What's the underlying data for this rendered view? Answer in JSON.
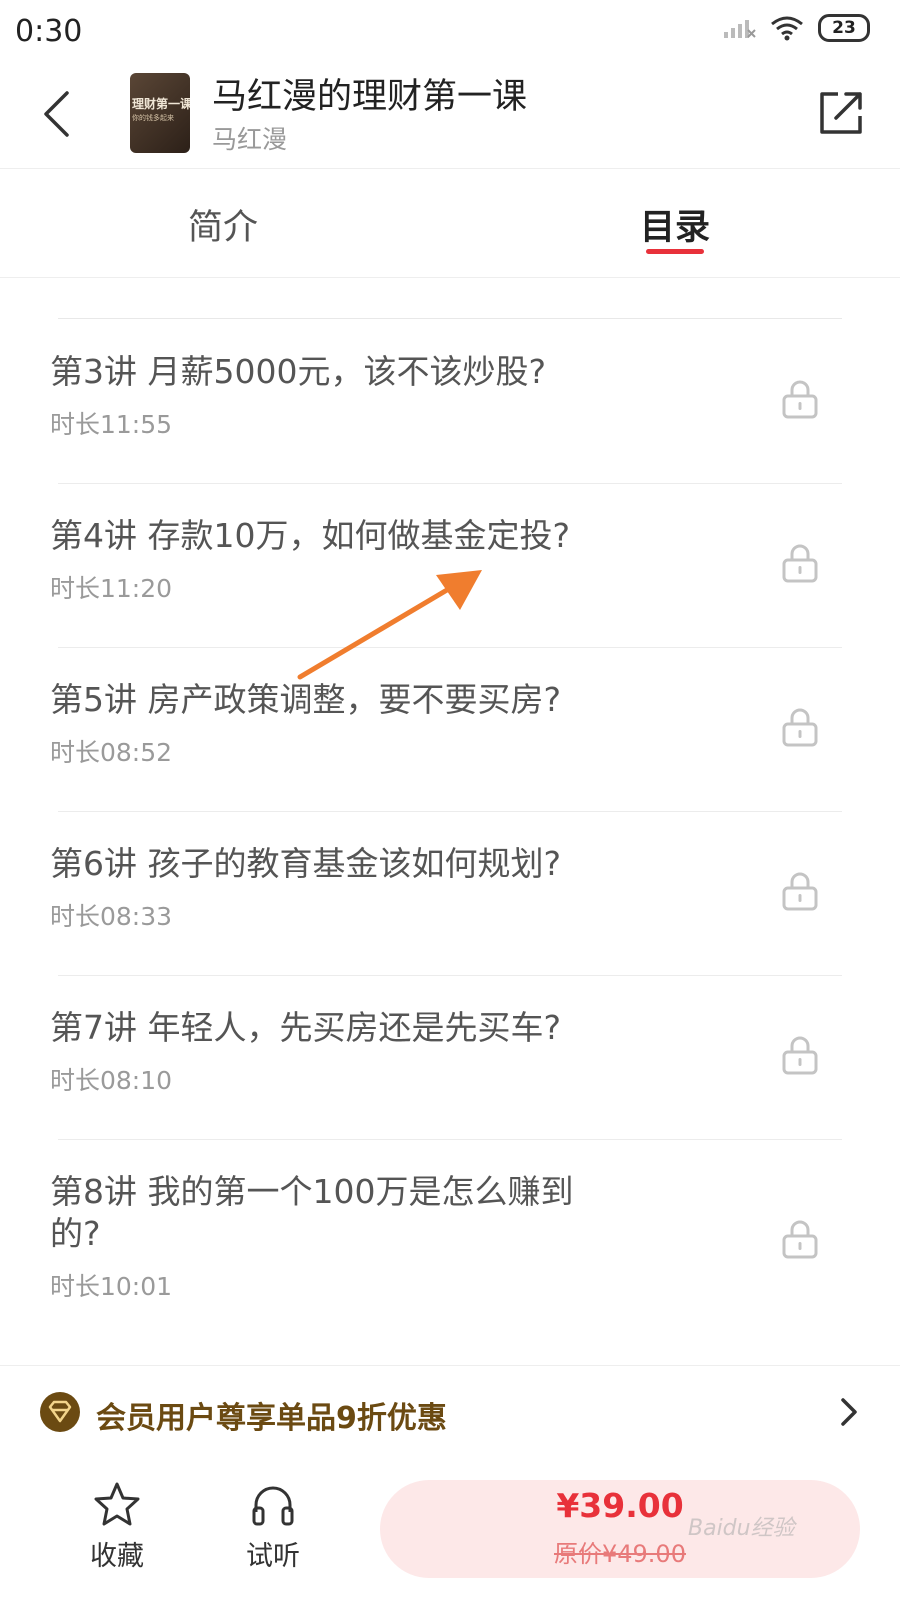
{
  "status_bar": {
    "time": "0:30",
    "battery": "23"
  },
  "header": {
    "title": "马红漫的理财第一课",
    "author": "马红漫",
    "cover_title": "理财第一课",
    "cover_subtitle": "你的钱多起来"
  },
  "tabs": [
    {
      "label": "简介",
      "active": false
    },
    {
      "label": "目录",
      "active": true
    }
  ],
  "lessons": [
    {
      "title": "第3讲 月薪5000元，该不该炒股?",
      "duration": "时长11:55",
      "locked": true
    },
    {
      "title": "第4讲 存款10万，如何做基金定投?",
      "duration": "时长11:20",
      "locked": true
    },
    {
      "title": "第5讲 房产政策调整，要不要买房?",
      "duration": "时长08:52",
      "locked": true
    },
    {
      "title": "第6讲 孩子的教育基金该如何规划?",
      "duration": "时长08:33",
      "locked": true
    },
    {
      "title": "第7讲 年轻人，先买房还是先买车?",
      "duration": "时长08:10",
      "locked": true
    },
    {
      "title": "第8讲 我的第一个100万是怎么赚到的?",
      "duration": "时长10:01",
      "locked": true
    }
  ],
  "member_banner": {
    "text": "会员用户尊享单品9折优惠"
  },
  "bottom_bar": {
    "favorite_label": "收藏",
    "listen_label": "试听",
    "price": "¥39.00",
    "original_price": "原价¥49.00"
  },
  "watermark": "Baidu经验",
  "colors": {
    "accent": "#e8313a",
    "member_gold": "#6b4a12",
    "buy_bg": "#fde8e8"
  },
  "icons": [
    "back-icon",
    "share-icon",
    "lock-icon",
    "member-badge-icon",
    "chevron-right-icon",
    "star-icon",
    "headphones-icon"
  ]
}
